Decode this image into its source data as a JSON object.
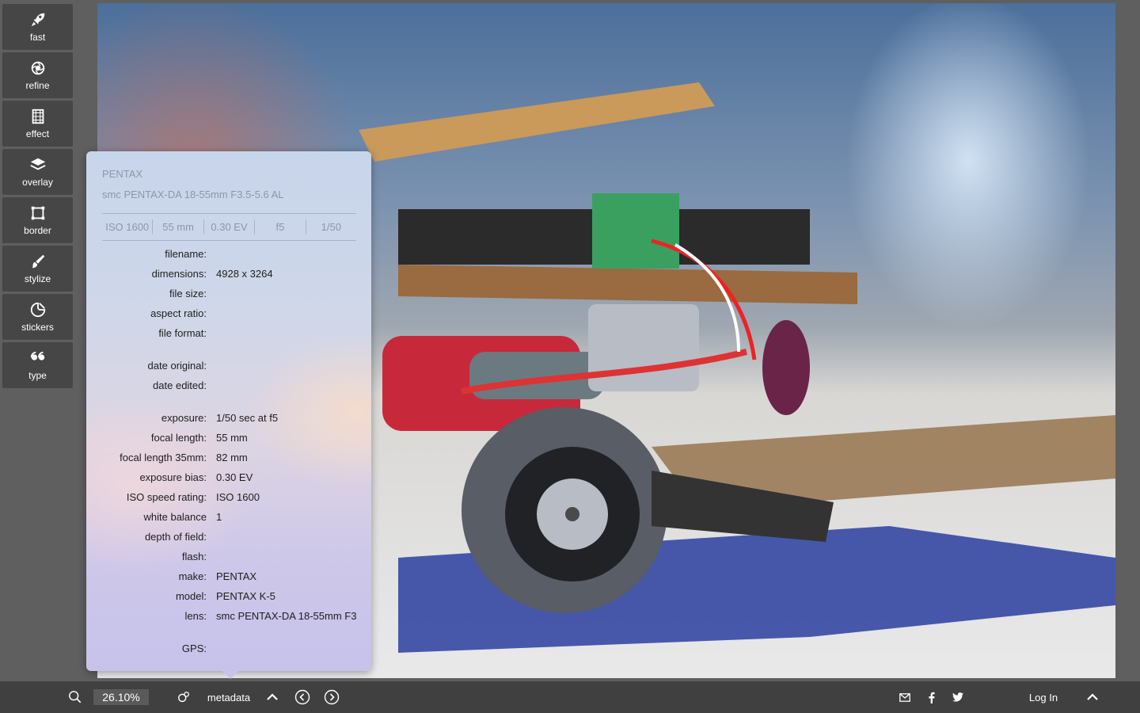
{
  "sidebar": {
    "items": [
      {
        "label": "fast",
        "icon": "rocket-icon"
      },
      {
        "label": "refine",
        "icon": "aperture-icon"
      },
      {
        "label": "effect",
        "icon": "film-icon"
      },
      {
        "label": "overlay",
        "icon": "layers-icon"
      },
      {
        "label": "border",
        "icon": "border-icon"
      },
      {
        "label": "stylize",
        "icon": "brush-icon"
      },
      {
        "label": "stickers",
        "icon": "sticker-icon"
      },
      {
        "label": "type",
        "icon": "quote-icon"
      }
    ]
  },
  "metadata": {
    "make_header": "PENTAX",
    "lens_header": "smc PENTAX-DA 18-55mm F3.5-5.6 AL",
    "summary": [
      "ISO 1600",
      "55 mm",
      "0.30 EV",
      "f5",
      "1/50"
    ],
    "rows": {
      "filename": {
        "key": "filename:",
        "value": ""
      },
      "dimensions": {
        "key": "dimensions:",
        "value": "4928 x 3264"
      },
      "file_size": {
        "key": "file size:",
        "value": ""
      },
      "aspect_ratio": {
        "key": "aspect ratio:",
        "value": ""
      },
      "file_format": {
        "key": "file format:",
        "value": ""
      },
      "date_original": {
        "key": "date original:",
        "value": ""
      },
      "date_edited": {
        "key": "date edited:",
        "value": ""
      },
      "exposure": {
        "key": "exposure:",
        "value": "1/50 sec at f5"
      },
      "focal_length": {
        "key": "focal length:",
        "value": "55 mm"
      },
      "focal_length_35": {
        "key": "focal length 35mm:",
        "value": "82 mm"
      },
      "exposure_bias": {
        "key": "exposure bias:",
        "value": "0.30 EV"
      },
      "iso": {
        "key": "ISO speed rating:",
        "value": "ISO 1600"
      },
      "white_balance": {
        "key": "white balance",
        "value": "1"
      },
      "depth_of_field": {
        "key": "depth of field:",
        "value": ""
      },
      "flash": {
        "key": "flash:",
        "value": ""
      },
      "make": {
        "key": "make:",
        "value": "PENTAX"
      },
      "model": {
        "key": "model:",
        "value": "PENTAX K-5"
      },
      "lens": {
        "key": "lens:",
        "value": "smc PENTAX-DA 18-55mm F3"
      },
      "gps": {
        "key": "GPS:",
        "value": ""
      }
    }
  },
  "bottombar": {
    "zoom_value": "26.10%",
    "metadata_label": "metadata",
    "login_label": "Log In"
  },
  "colors": {
    "background": "#5f5f5f",
    "tool_button": "#464646",
    "bottombar": "#404040"
  }
}
